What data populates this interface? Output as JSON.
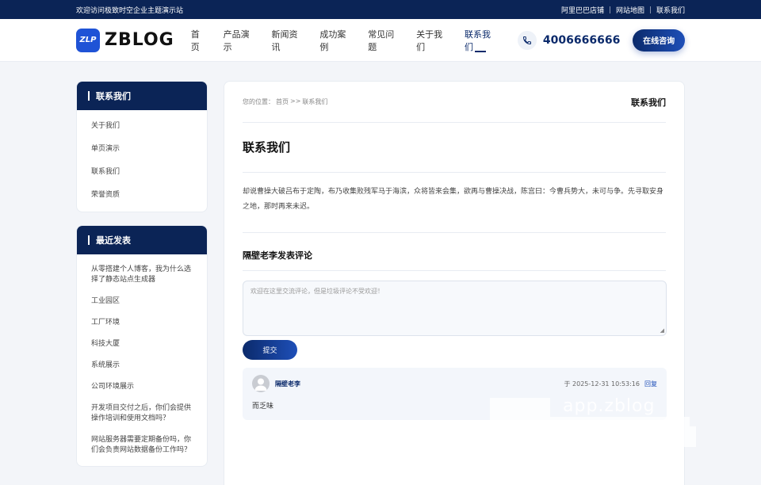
{
  "topbar": {
    "welcome": "欢迎访问极致时空企业主题演示站",
    "links": [
      "阿里巴巴店铺",
      "网站地图",
      "联系我们"
    ]
  },
  "header": {
    "logo_mark": "ZLP",
    "logo_text": "ZBLOG",
    "nav": [
      "首页",
      "产品演示",
      "新闻资讯",
      "成功案例",
      "常见问题",
      "关于我们",
      "联系我们"
    ],
    "active_nav": "联系我们",
    "phone": "4006666666",
    "consult_label": "在线咨询"
  },
  "sidebar": {
    "box1_title": "联系我们",
    "box1_links": [
      "关于我们",
      "单页演示",
      "联系我们",
      "荣誉资质"
    ],
    "box2_title": "最近发表",
    "box2_links": [
      "从零搭建个人博客，我为什么选择了静态站点生成器",
      "工业园区",
      "工厂环境",
      "科技大厦",
      "系统展示",
      "公司环境展示",
      "开发项目交付之后，你们会提供操作培训和使用文档吗？",
      "网站服务器需要定期备份吗，你们会负责网站数据备份工作吗？"
    ]
  },
  "main": {
    "breadcrumb_prefix": "您的位置：",
    "breadcrumb_home": "首页",
    "breadcrumb_sep": ">>",
    "breadcrumb_current": "联系我们",
    "crumb_title": "联系我们",
    "page_title": "联系我们",
    "article": "却说曹操大破吕布于定陶，布乃收集败残军马于海滨，众将皆来会集，欲再与曹操决战，陈宫曰：今曹兵势大，未可与争。先寻取安身之地，那时再来未迟。",
    "comment_heading": "隔壁老李发表评论",
    "comment_placeholder": "欢迎在这里交流评论，但是垃圾评论不受欢迎！",
    "submit_label": "提交",
    "comment": {
      "author": "隔壁老李",
      "time": "于 2025-12-31 10:53:16",
      "reply_label": "回复",
      "text": "而乏味"
    }
  },
  "watermark": {
    "text": "app.zblog"
  },
  "colors": {
    "navy": "#0b2456",
    "accent": "#1e4fb8",
    "logo_blue": "#1f53d6"
  }
}
